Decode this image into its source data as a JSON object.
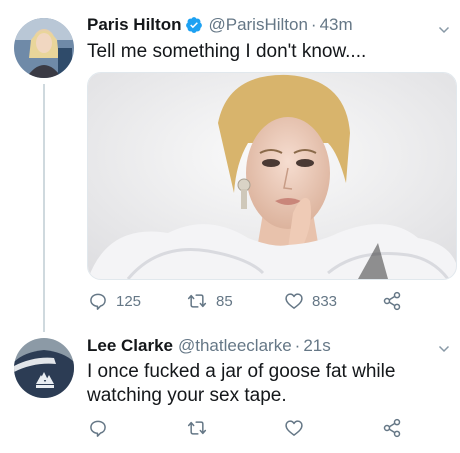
{
  "tweets": [
    {
      "name": "Paris Hilton",
      "handle": "@ParisHilton",
      "separator": "·",
      "time": "43m",
      "verified": true,
      "text": "Tell me something I don't know....",
      "replies": "125",
      "retweets": "85",
      "likes": "833"
    },
    {
      "name": "Lee Clarke",
      "handle": "@thatleeclarke",
      "separator": "·",
      "time": "21s",
      "verified": false,
      "text": "I once fucked a jar of goose fat while watching your sex tape.",
      "replies": "",
      "retweets": "",
      "likes": ""
    }
  ],
  "colors": {
    "verified": "#1da1f2",
    "secondary_text": "#657786",
    "primary_text": "#14171a"
  },
  "icons": {
    "reply": "reply-icon",
    "retweet": "retweet-icon",
    "like": "heart-icon",
    "share": "share-icon",
    "more": "chevron-down-icon"
  }
}
